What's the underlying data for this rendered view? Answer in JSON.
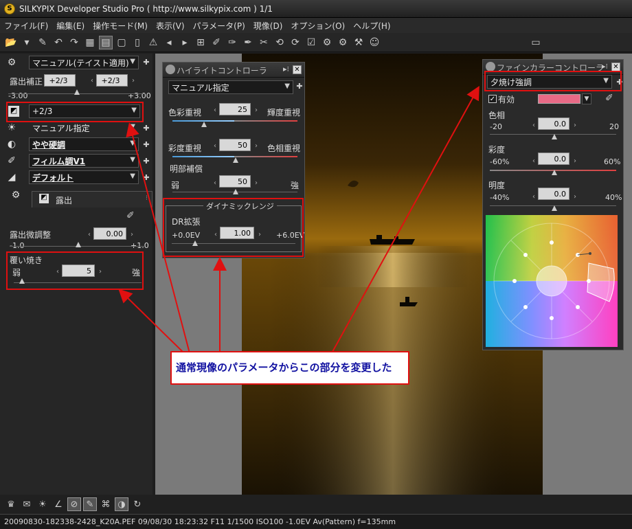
{
  "window": {
    "title": "SILKYPIX Developer Studio Pro ( http://www.silkypix.com )  1/1",
    "app_icon": "silkypix-logo"
  },
  "menu": [
    "ファイル(F)",
    "編集(E)",
    "操作モード(M)",
    "表示(V)",
    "パラメータ(P)",
    "現像(D)",
    "オプション(O)",
    "ヘルプ(H)"
  ],
  "left_panel": {
    "taste_dropdown": "マニュアル(テイスト適用)",
    "exposure_label": "露出補正",
    "exposure_value": "+2/3",
    "exposure_value2": "+2/3",
    "exposure_min": "-3.00",
    "exposure_max": "+3.00",
    "exposure_dropdown": "+2/3",
    "wb_dropdown": "マニュアル指定",
    "contrast_dropdown": "やや硬調",
    "color_dropdown": "フィルム調V1",
    "sharp_dropdown": "デフォルト",
    "tab_label": "露出",
    "fine_exposure_label": "露出微調整",
    "fine_exposure_value": "0.00",
    "fine_exposure_min": "-1.0",
    "fine_exposure_max": "+1.0",
    "dodge_label": "覆い焼き",
    "dodge_weak": "弱",
    "dodge_value": "5",
    "dodge_strong": "強"
  },
  "highlight_controller": {
    "title": "ハイライトコントローラ",
    "dropdown": "マニュアル指定",
    "color_priority_label": "色彩重視",
    "color_priority_value": "25",
    "luminance_priority_label": "輝度重視",
    "saturation_label": "彩度重視",
    "saturation_value": "50",
    "hue_priority_label": "色相重視",
    "brightness_comp_label": "明部補償",
    "brightness_weak": "弱",
    "brightness_value": "50",
    "brightness_strong": "強",
    "dr_group_label": "ダイナミックレンジ",
    "dr_label": "DR拡張",
    "dr_min": "+0.0EV",
    "dr_value": "1.00",
    "dr_max": "+6.0EV"
  },
  "fine_color_controller": {
    "title": "ファインカラーコントローラ",
    "preset": "夕焼け強調",
    "enabled_label": "有効",
    "enabled": true,
    "swatch_color": "#e86a86",
    "hue_label": "色相",
    "hue_min": "-20",
    "hue_value": "0.0",
    "hue_max": "20",
    "sat_label": "彩度",
    "sat_min": "-60%",
    "sat_value": "0.0",
    "sat_max": "60%",
    "bri_label": "明度",
    "bri_min": "-40%",
    "bri_value": "0.0",
    "bri_max": "40%"
  },
  "callout": {
    "text": "通常現像のパラメータからこの部分を変更した"
  },
  "status": {
    "text": "20090830-182338-2428_K20A.PEF 09/08/30 18:23:32 F11 1/1500 ISO100 -1.0EV Av(Pattern) f=135mm"
  },
  "colors": {
    "accent_red": "#e01010",
    "callout_text": "#1010a0",
    "panel_bg": "#262626"
  }
}
